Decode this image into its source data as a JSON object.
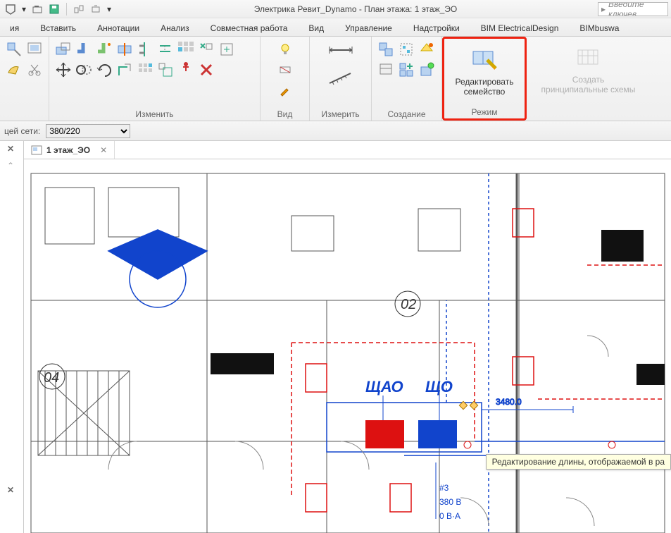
{
  "title": "Электрика Ревит_Dynamo - План этажа: 1 этаж_ЭО",
  "search_placeholder": "Введите ключев",
  "tabs": [
    "ия",
    "Вставить",
    "Аннотации",
    "Анализ",
    "Совместная работа",
    "Вид",
    "Управление",
    "Надстройки",
    "BIM ElectricalDesign",
    "BIMbuswa"
  ],
  "panels": {
    "modify": "Изменить",
    "view": "Вид",
    "measure": "Измерить",
    "create": "Создание",
    "mode": "Режим",
    "edit_family": "Редактировать\nсемейство",
    "create_scheme": "Создать\nпринципиальные схемы"
  },
  "optbar": {
    "label": "цей сети:",
    "value": "380/220"
  },
  "viewtab": {
    "name": "1 этаж_ЭО"
  },
  "plan": {
    "room1": "02",
    "room2": "04",
    "panel1": "ЩАО",
    "panel2": "ЩО",
    "dim": "3480.0",
    "circuits": "#3",
    "voltage": "380 В",
    "power": "0 В·А"
  },
  "tooltip": "Редактирование длины, отображаемой в ра"
}
